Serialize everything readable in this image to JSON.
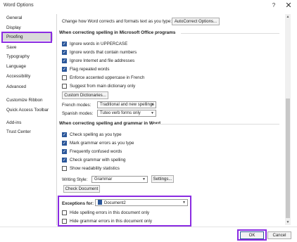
{
  "window": {
    "title": "Word Options",
    "help_glyph": "?",
    "close_glyph": "✕"
  },
  "sidebar": {
    "items": [
      {
        "label": "General"
      },
      {
        "label": "Display"
      },
      {
        "label": "Proofing",
        "selected": true
      },
      {
        "label": "Save"
      },
      {
        "label": "Typography"
      },
      {
        "label": "Language"
      },
      {
        "label": "Accessibility"
      },
      {
        "label": "Advanced"
      },
      {
        "label": "Customize Ribbon"
      },
      {
        "label": "Quick Access Toolbar"
      },
      {
        "label": "Add-ins"
      },
      {
        "label": "Trust Center"
      }
    ]
  },
  "autocorrect": {
    "text": "Change how Word corrects and formats text as you type:",
    "button": "AutoCorrect Options..."
  },
  "office_section": {
    "title": "When correcting spelling in Microsoft Office programs",
    "checkboxes": [
      {
        "label": "Ignore words in UPPERCASE",
        "checked": true
      },
      {
        "label": "Ignore words that contain numbers",
        "checked": true
      },
      {
        "label": "Ignore Internet and file addresses",
        "checked": true
      },
      {
        "label": "Flag repeated words",
        "checked": true
      },
      {
        "label": "Enforce accented uppercase in French",
        "checked": false
      },
      {
        "label": "Suggest from main dictionary only",
        "checked": false
      }
    ],
    "custom_dictionaries_button": "Custom Dictionaries...",
    "french_modes_label": "French modes:",
    "french_modes_value": "Traditional and new spellings",
    "spanish_modes_label": "Spanish modes:",
    "spanish_modes_value": "Tuteo verb forms only"
  },
  "word_section": {
    "title": "When correcting spelling and grammar in Word",
    "checkboxes": [
      {
        "label": "Check spelling as you type",
        "checked": true
      },
      {
        "label": "Mark grammar errors as you type",
        "checked": true
      },
      {
        "label": "Frequently confused words",
        "checked": true
      },
      {
        "label": "Check grammar with spelling",
        "checked": true
      },
      {
        "label": "Show readability statistics",
        "checked": false
      }
    ],
    "writing_style_label": "Writing Style:",
    "writing_style_value": "Grammar",
    "settings_button": "Settings...",
    "check_document_button": "Check Document"
  },
  "exceptions": {
    "label": "Exceptions for:",
    "document_value": "Document2",
    "checkboxes": [
      {
        "label": "Hide spelling errors in this document only",
        "checked": false
      },
      {
        "label": "Hide grammar errors in this document only",
        "checked": false
      }
    ]
  },
  "footer": {
    "ok": "OK",
    "cancel": "Cancel"
  },
  "colors": {
    "highlight": "#8a2be2",
    "accent": "#2b579a"
  },
  "icons": {
    "scroll_up": "▲",
    "scroll_down": "▼",
    "dropdown": "▼"
  }
}
